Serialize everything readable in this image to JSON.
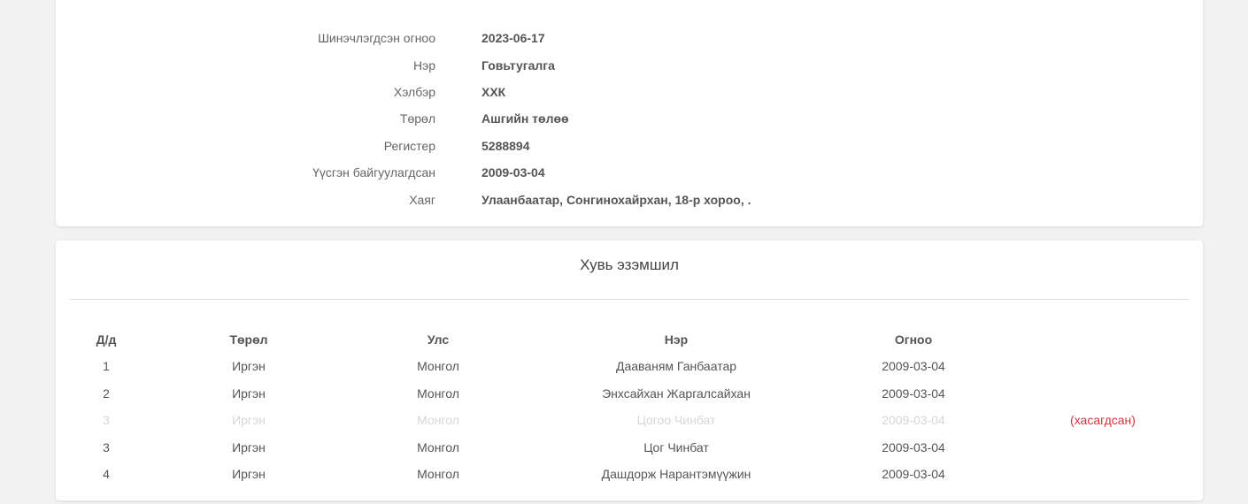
{
  "company_info": {
    "rows": [
      {
        "label": "Шинэчлэгдсэн огноо",
        "value": "2023-06-17"
      },
      {
        "label": "Нэр",
        "value": "Говьтугалга"
      },
      {
        "label": "Хэлбэр",
        "value": "ХХК"
      },
      {
        "label": "Төрөл",
        "value": "Ашгийн төлөө"
      },
      {
        "label": "Регистер",
        "value": "5288894"
      },
      {
        "label": "Үүсгэн байгуулагдсан",
        "value": "2009-03-04"
      },
      {
        "label": "Хаяг",
        "value": "Улаанбаатар, Сонгинохайрхан, 18-р хороо, ."
      }
    ]
  },
  "ownership": {
    "title": "Хувь эзэмшил",
    "columns": {
      "no": "Д/д",
      "type": "Төрөл",
      "country": "Улс",
      "name": "Нэр",
      "date": "Огноо"
    },
    "rows": [
      {
        "no": "1",
        "type": "Иргэн",
        "country": "Монгол",
        "name": "Дааваням Ганбаатар",
        "date": "2009-03-04",
        "status": ""
      },
      {
        "no": "2",
        "type": "Иргэн",
        "country": "Монгол",
        "name": "Энхсайхан Жаргалсайхан",
        "date": "2009-03-04",
        "status": ""
      },
      {
        "no": "3",
        "type": "Иргэн",
        "country": "Монгол",
        "name": "Цогоо Чинбат",
        "date": "2009-03-04",
        "status": "(хасагдсан)"
      },
      {
        "no": "3",
        "type": "Иргэн",
        "country": "Монгол",
        "name": "Цог Чинбат",
        "date": "2009-03-04",
        "status": ""
      },
      {
        "no": "4",
        "type": "Иргэн",
        "country": "Монгол",
        "name": "Дашдорж Нарантэмүүжин",
        "date": "2009-03-04",
        "status": ""
      }
    ]
  },
  "colors": {
    "page_background": "#f2f2f2",
    "card_background": "#ffffff",
    "text": "#555555",
    "removed_text": "#d6d6d6",
    "removed_badge": "#d9323f"
  }
}
